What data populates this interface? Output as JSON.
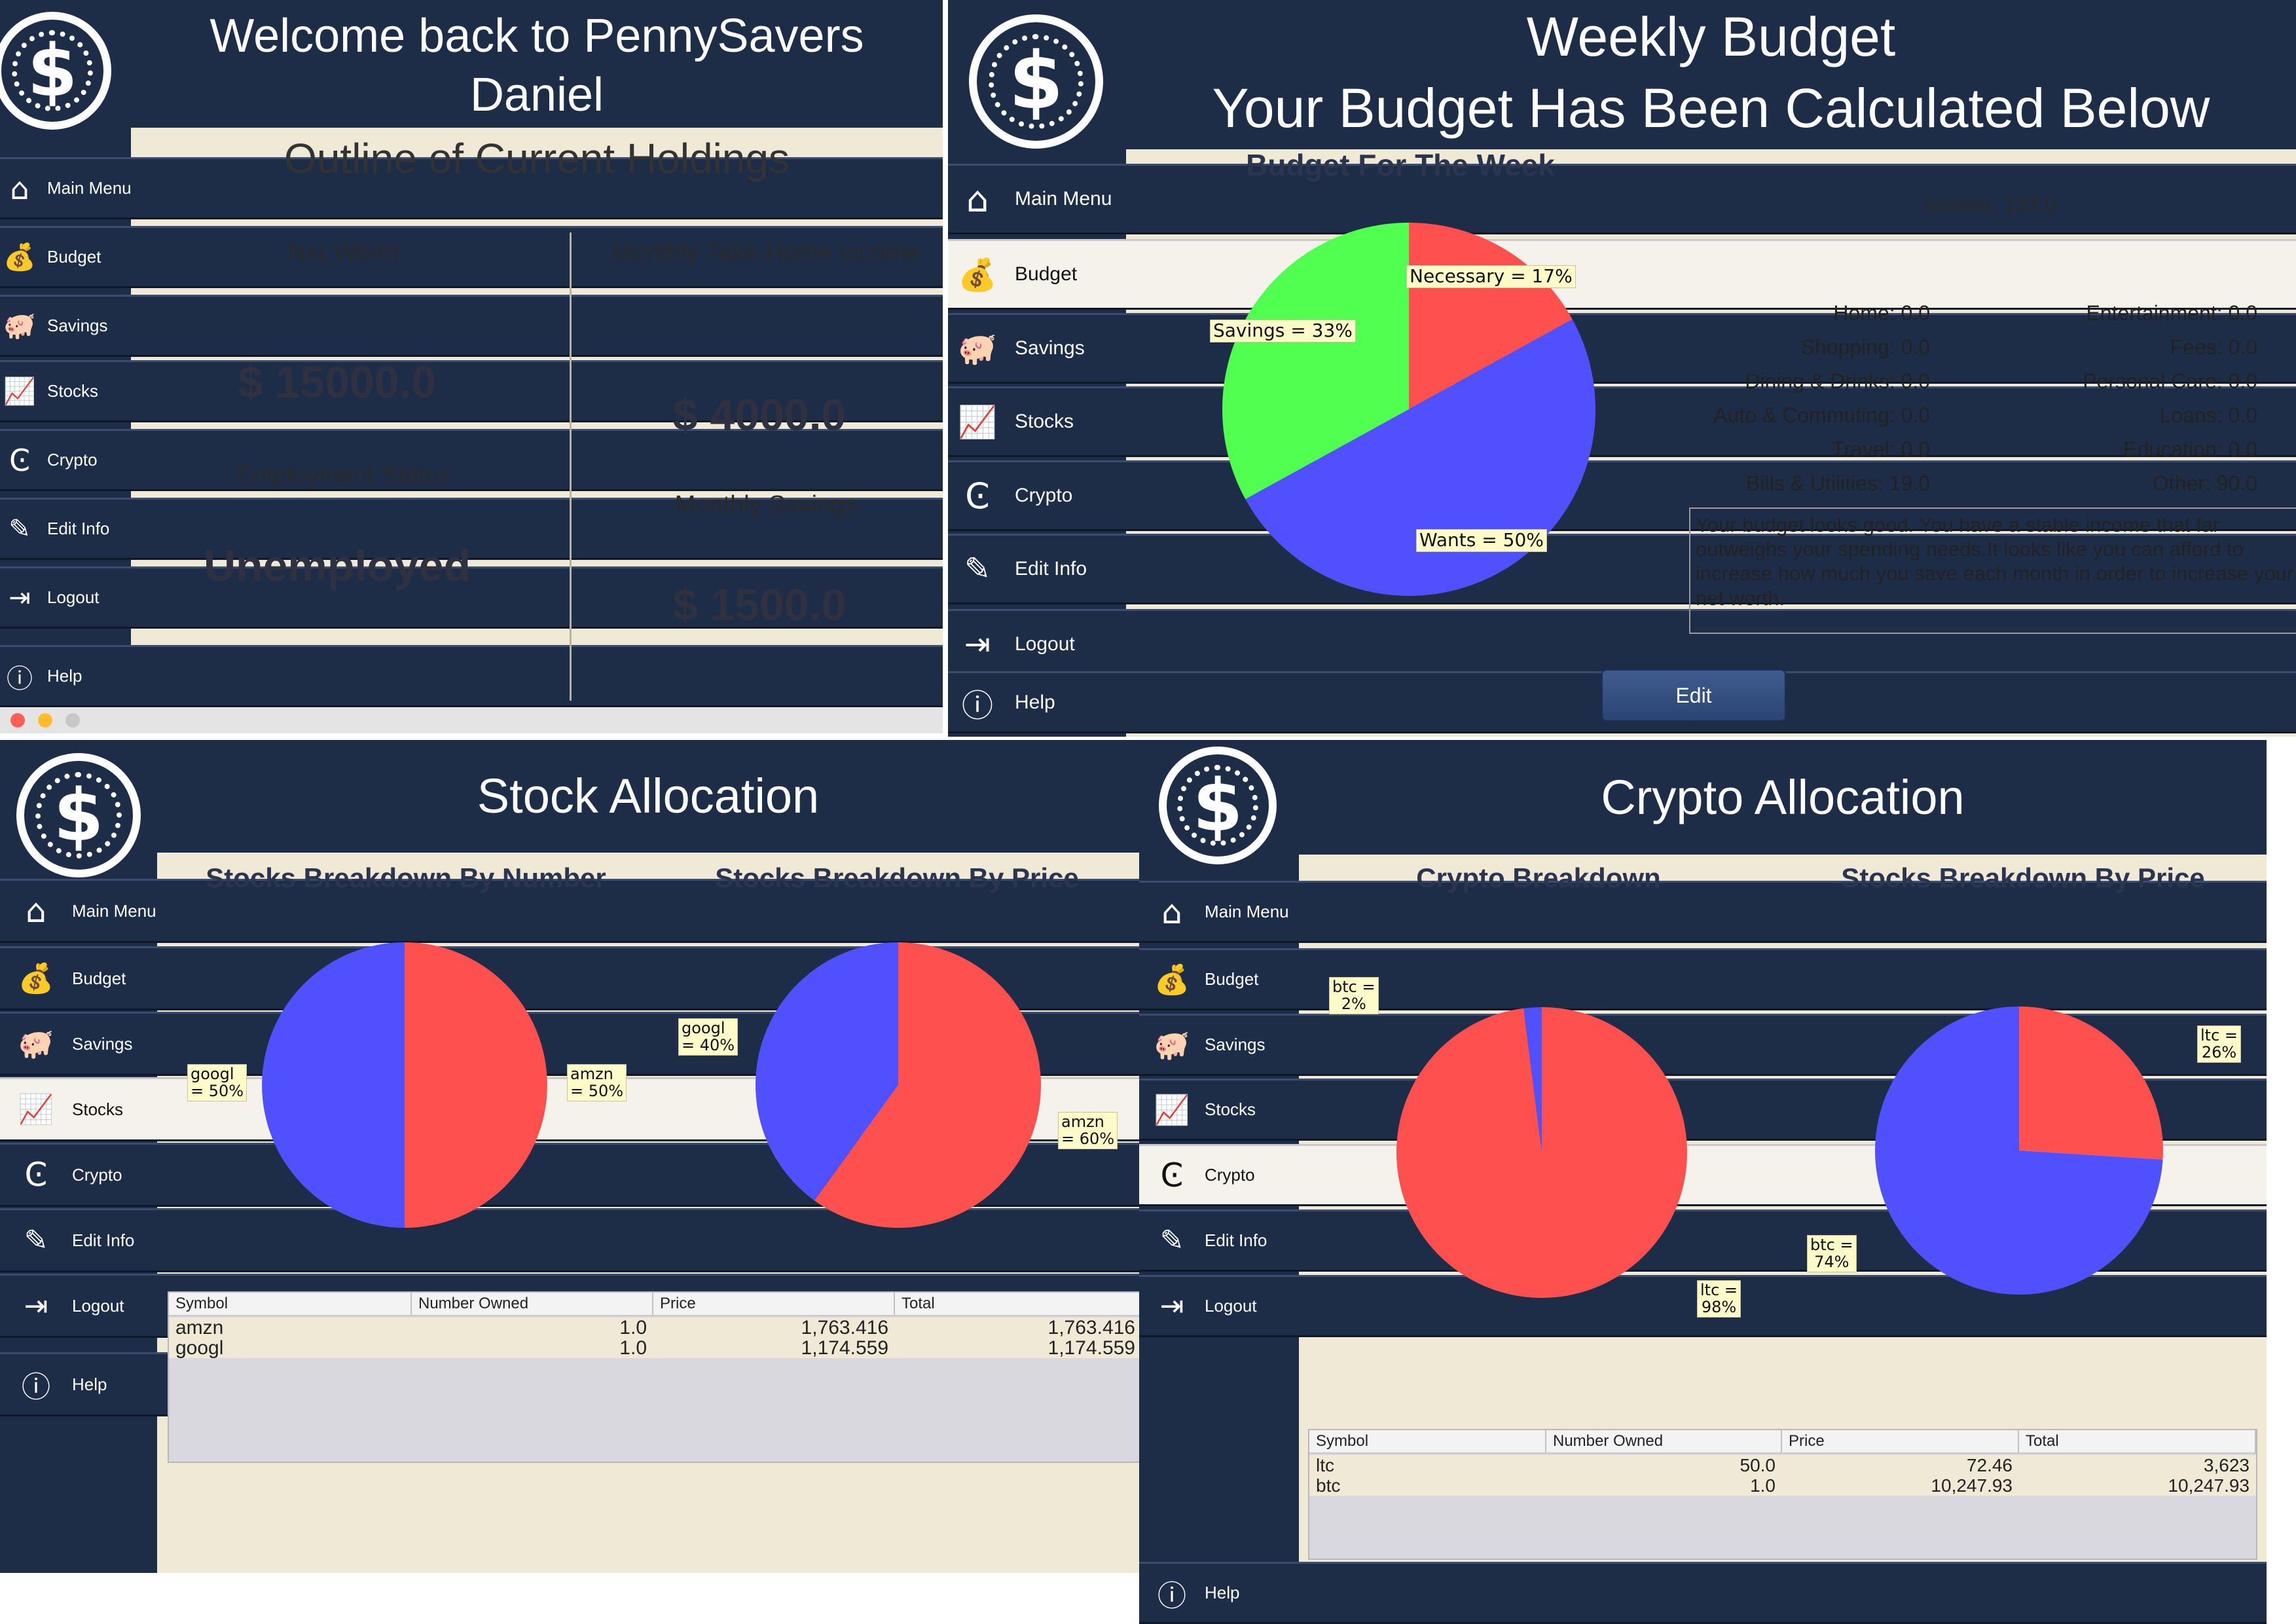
{
  "colors": {
    "navy": "#1e2d47",
    "cream": "#efe9d6",
    "red": "#ff5050",
    "blue": "#5050ff",
    "green": "#50ff50"
  },
  "nav_labels": {
    "main_menu": "Main Menu",
    "budget": "Budget",
    "savings": "Savings",
    "stocks": "Stocks",
    "crypto": "Crypto",
    "edit_info": "Edit Info",
    "logout": "Logout",
    "help": "Help"
  },
  "icons": {
    "main_menu": "house-icon",
    "budget": "money-bag-calculator-icon",
    "savings": "piggy-bank-icon",
    "stocks": "bar-chart-icon",
    "crypto": "crypto-coin-icon",
    "edit_info": "edit-icon",
    "logout": "logout-icon",
    "help": "question-icon"
  },
  "dashboard": {
    "title_line1": "Welcome back to PennySavers",
    "title_line2": "Daniel",
    "subtitle": "Outline of Current Holdings",
    "net_worth_label": "Net Worth",
    "net_worth_value": "$ 15000.0",
    "income_label": "Monthly Take Home Income",
    "income_value": "$ 4000.0",
    "employment_label": "Employment Status",
    "employment_value": "Unemployed",
    "savings_label": "Monthly Savings",
    "savings_value": "$ 1500.0"
  },
  "budget": {
    "title_line1": "Weekly Budget",
    "title_line2": "Your Budget Has Been Calculated Below",
    "income": "Income:  123.0",
    "rows_left": [
      "Home:  0.0",
      "Shopping:  0.0",
      "Dining & Drinks:  0.0",
      "Auto & Commuting:  0.0",
      "Travel:  0.0",
      "Bills & Utilities:  19.0"
    ],
    "rows_right": [
      "Entertainment:  0.0",
      "Fees:  0.0",
      "Personal Care:  0.0",
      "Loans:  0.0",
      "Education:  0.0",
      "Other:  90.0"
    ],
    "advice": "Your budget looks good. You have a stable income that far outweighs your spending needs.It looks like you can afford to increase how much you save each month in order to increase your net worth.",
    "edit_button": "Edit"
  },
  "stocks": {
    "title": "Stock Allocation",
    "columns": [
      "Symbol",
      "Number Owned",
      "Price",
      "Total"
    ],
    "rows": [
      [
        "amzn",
        "1.0",
        "1,763.416",
        "1,763.416"
      ],
      [
        "googl",
        "1.0",
        "1,174.559",
        "1,174.559"
      ]
    ]
  },
  "crypto": {
    "title": "Crypto Allocation",
    "columns": [
      "Symbol",
      "Number Owned",
      "Price",
      "Total"
    ],
    "rows": [
      [
        "ltc",
        "50.0",
        "72.46",
        "3,623"
      ],
      [
        "btc",
        "1.0",
        "10,247.93",
        "10,247.93"
      ]
    ]
  },
  "chart_data": [
    {
      "type": "pie",
      "title": "Budget For The Week",
      "slices": [
        {
          "label": "Necessary = 17%",
          "value": 17,
          "color": "#ff5050"
        },
        {
          "label": "Wants = 50%",
          "value": 50,
          "color": "#5050ff"
        },
        {
          "label": "Savings = 33%",
          "value": 33,
          "color": "#50ff50"
        }
      ]
    },
    {
      "type": "pie",
      "title": "Stocks Breakdown By Number",
      "slices": [
        {
          "label": "amzn\n= 50%",
          "value": 50,
          "color": "#ff5050"
        },
        {
          "label": "googl\n= 50%",
          "value": 50,
          "color": "#5050ff"
        }
      ]
    },
    {
      "type": "pie",
      "title": "Stocks Breakdown By Price",
      "slices": [
        {
          "label": "amzn\n= 60%",
          "value": 60,
          "color": "#ff5050"
        },
        {
          "label": "googl\n= 40%",
          "value": 40,
          "color": "#5050ff"
        }
      ]
    },
    {
      "type": "pie",
      "title": "Crypto Breakdown",
      "slices": [
        {
          "label": "ltc =\n98%",
          "value": 98,
          "color": "#ff5050"
        },
        {
          "label": "btc =\n2%",
          "value": 2,
          "color": "#5050ff"
        }
      ]
    },
    {
      "type": "pie",
      "title": "Stocks Breakdown By Price",
      "slices": [
        {
          "label": "ltc =\n26%",
          "value": 26,
          "color": "#ff5050"
        },
        {
          "label": "btc =\n74%",
          "value": 74,
          "color": "#5050ff"
        }
      ]
    }
  ]
}
